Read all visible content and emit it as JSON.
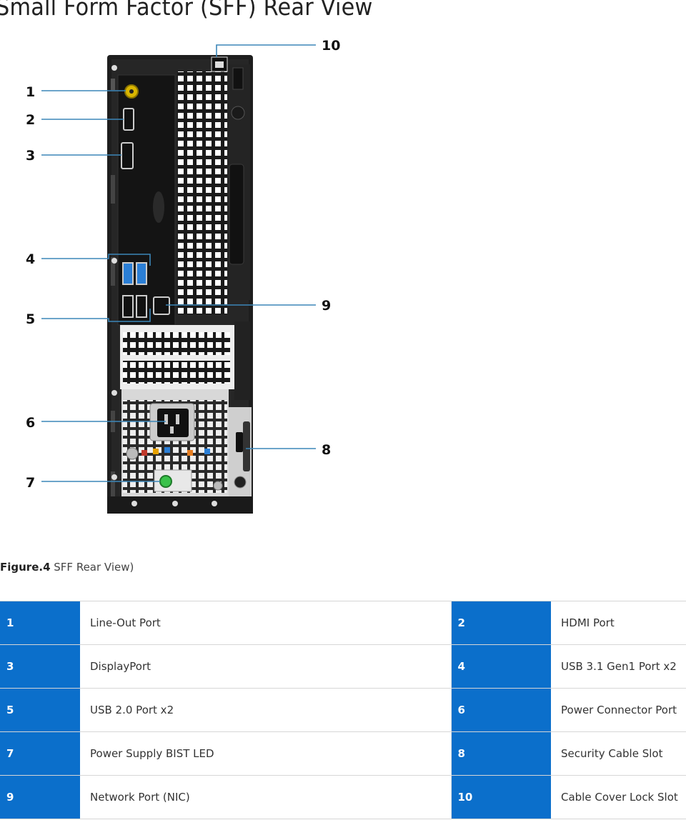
{
  "page": {
    "title": "Small Form Factor (SFF) Rear View"
  },
  "figure": {
    "callouts": [
      "1",
      "2",
      "3",
      "4",
      "5",
      "6",
      "7",
      "8",
      "9",
      "10"
    ],
    "caption_bold": "Figure.4",
    "caption_text": " SFF Rear View)"
  },
  "legend": {
    "rows": [
      {
        "left_num": "1",
        "left_label": "Line-Out Port",
        "right_num": "2",
        "right_label": "HDMI Port"
      },
      {
        "left_num": "3",
        "left_label": "DisplayPort",
        "right_num": "4",
        "right_label": "USB 3.1 Gen1 Port x2"
      },
      {
        "left_num": "5",
        "left_label": "USB 2.0 Port x2",
        "right_num": "6",
        "right_label": "Power Connector Port"
      },
      {
        "left_num": "7",
        "left_label": "Power Supply BIST LED",
        "right_num": "8",
        "right_label": "Security Cable Slot"
      },
      {
        "left_num": "9",
        "left_label": "Network Port (NIC)",
        "right_num": "10",
        "right_label": "Cable Cover Lock Slot"
      }
    ]
  },
  "colors": {
    "accent": "#0b6fcb",
    "callout_line": "#3b86b8",
    "chassis": "#1e1e1e",
    "usb3": "#2b7fd6",
    "led": "#39c24a",
    "audio": "#d9b500"
  }
}
